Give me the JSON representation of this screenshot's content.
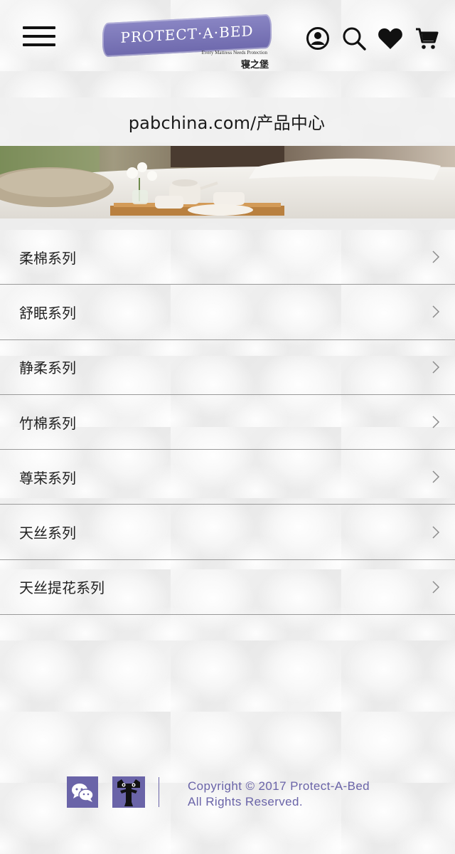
{
  "header": {
    "brand": {
      "name": "PROTECT·A·BED",
      "tagline": "Every Mattress Needs Protection",
      "cn_name": "寝之堡"
    },
    "icons": [
      "menu-icon",
      "user-icon",
      "search-icon",
      "heart-icon",
      "cart-icon"
    ]
  },
  "page_title": "pabchina.com/产品中心",
  "series": [
    {
      "label": "柔棉系列"
    },
    {
      "label": "舒眠系列"
    },
    {
      "label": "静柔系列"
    },
    {
      "label": "竹棉系列"
    },
    {
      "label": "尊荣系列"
    },
    {
      "label": "天丝系列"
    },
    {
      "label": "天丝提花系列"
    }
  ],
  "footer": {
    "copyright_line1": "Copyright  © 2017 Protect-A-Bed",
    "copyright_line2": "All Rights Reserved.",
    "icons": [
      "wechat-icon",
      "tmall-icon"
    ]
  },
  "colors": {
    "brand_purple": "#6a64a8",
    "text": "#222222",
    "divider": "#9a9a9a"
  }
}
